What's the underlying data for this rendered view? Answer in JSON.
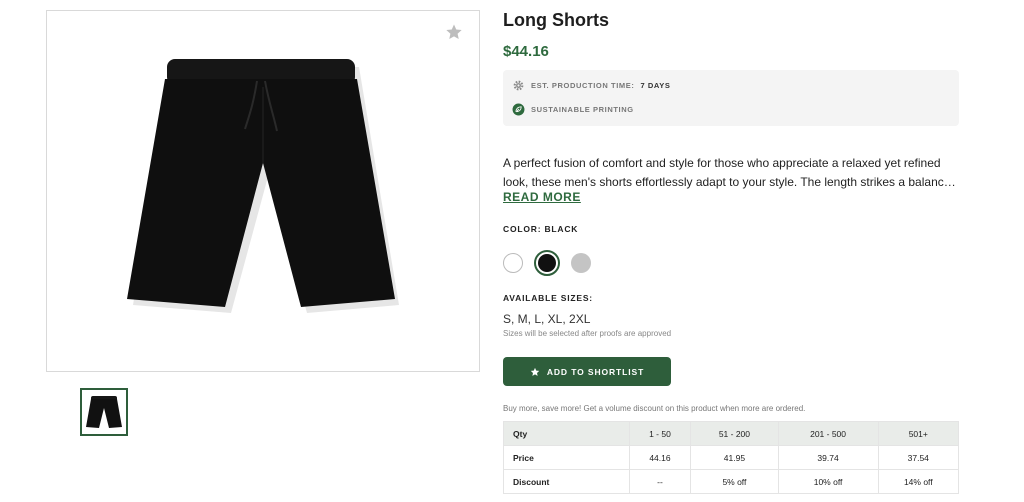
{
  "product": {
    "title": "Long Shorts",
    "price": "$44.16",
    "production_label": "EST. PRODUCTION TIME:",
    "production_value": "7 DAYS",
    "sustainable_label": "SUSTAINABLE PRINTING",
    "description_line1": "A perfect fusion of comfort and style for those who appreciate a relaxed yet refined",
    "description_line2": "look, these men's shorts effortlessly adapt to your style. The length strikes a balanc…",
    "read_more": "READ MORE",
    "color_label": "COLOR: BLACK",
    "colors": [
      {
        "name": "white",
        "hex": "#ffffff"
      },
      {
        "name": "black",
        "hex": "#111111",
        "selected": true
      },
      {
        "name": "gray",
        "hex": "#c4c4c4"
      }
    ],
    "sizes_label": "AVAILABLE SIZES:",
    "sizes": "S, M, L, XL, 2XL",
    "sizes_note": "Sizes will be selected after proofs are approved",
    "shortlist_label": "ADD TO SHORTLIST",
    "bulk_note": "Buy more, save more! Get a volume discount on this product when more are ordered."
  },
  "pricing_table": {
    "headers": [
      "Qty",
      "1 - 50",
      "51 - 200",
      "201 - 500",
      "501+"
    ],
    "price_row": [
      "Price",
      "44.16",
      "41.95",
      "39.74",
      "37.54"
    ],
    "discount_row": [
      "Discount",
      "--",
      "5% off",
      "10% off",
      "14% off"
    ]
  },
  "colors": {
    "accent": "#2e5e3b",
    "price": "#2e6a3e"
  }
}
